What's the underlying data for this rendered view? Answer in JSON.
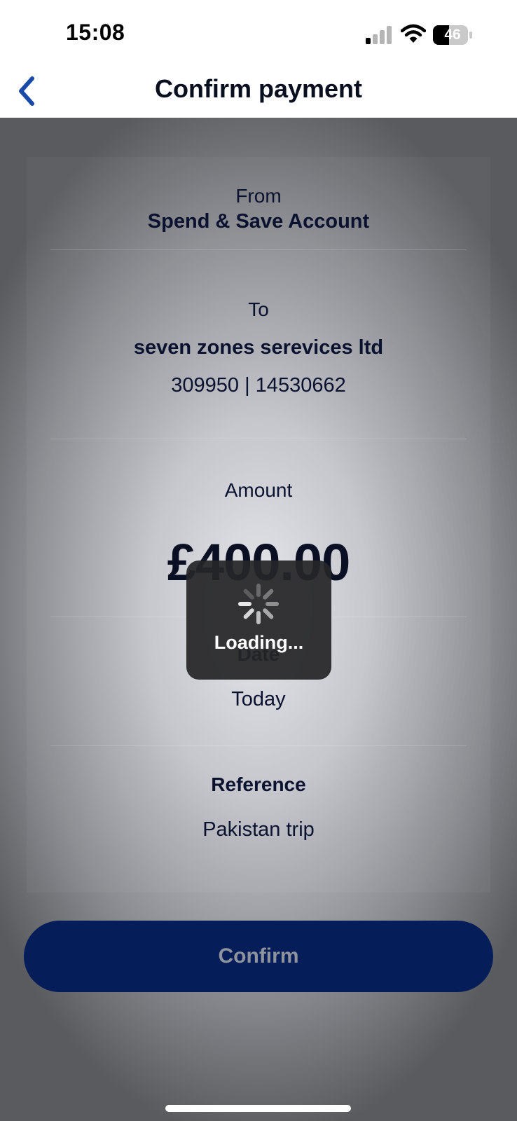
{
  "status_bar": {
    "time": "15:08",
    "battery": "46",
    "icons": [
      "signal-icon",
      "wifi-icon",
      "battery-icon"
    ]
  },
  "nav": {
    "title": "Confirm payment",
    "back_icon": "chevron-left-icon"
  },
  "payment": {
    "from_label": "From",
    "from_account": "Spend & Save Account",
    "to_label": "To",
    "payee_name": "seven zones serevices ltd",
    "payee_details": "309950 | 14530662",
    "amount_label": "Amount",
    "amount": "£400.00",
    "date_label": "Date",
    "date_value": "Today",
    "reference_label": "Reference",
    "reference_value": "Pakistan trip"
  },
  "actions": {
    "confirm_label": "Confirm"
  },
  "loading": {
    "text": "Loading...",
    "icon": "spinner-icon"
  },
  "colors": {
    "button": "#051e5a",
    "back_icon": "#1a4aa8",
    "text": "#0b1230"
  }
}
